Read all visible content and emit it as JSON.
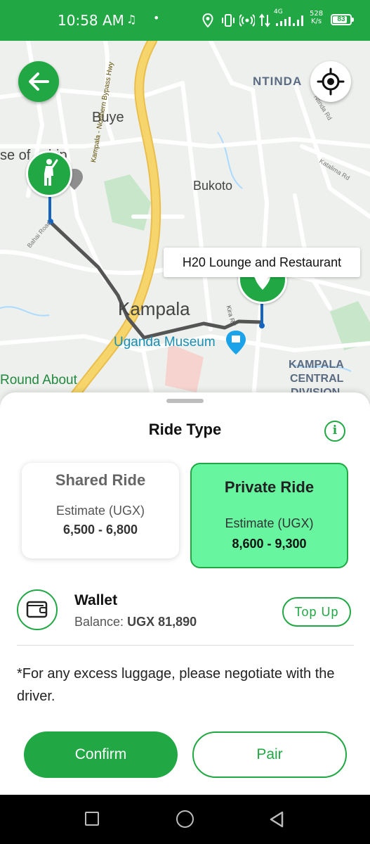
{
  "status_bar": {
    "time": "10:58 AM",
    "network_type": "4G",
    "speed_value": "528",
    "speed_unit": "K/s",
    "battery_percent": 83,
    "battery_label": "83",
    "icons": [
      "music-note-icon",
      "dot-icon",
      "location-icon",
      "vibrate-icon",
      "hotspot-icon",
      "data-arrows-icon",
      "signal-icon",
      "battery-icon"
    ]
  },
  "map": {
    "labels": {
      "ntinda": "NTINDA",
      "ntinda_rd": "Ntinda Rd",
      "buye": "Buye",
      "house": "se of  ship",
      "bypass": "Kampala - Northern Bypass Hwy",
      "katalima": "Katalima Rd",
      "bukoto": "Bukoto",
      "bahai": "Bahai Road",
      "kampala": "Kampala",
      "kira": "Kira Rd",
      "museum": "Uganda Museum",
      "roundabout": "Round About",
      "central_1": "KAMPALA",
      "central_2": "CENTRAL",
      "central_3": "DIVISION"
    },
    "destination_callout": "H20 Lounge and Restaurant",
    "colors": {
      "route": "#555555",
      "pin_stick": "#1565c0",
      "highway": "#f6d66c",
      "water": "#aadaff",
      "park": "#c8e6c9"
    }
  },
  "sheet": {
    "title": "Ride Type",
    "info_glyph": "i",
    "options": [
      {
        "title": "Shared Ride",
        "estimate_label": "Estimate (UGX)",
        "range": "6,500 - 6,800",
        "selected": false
      },
      {
        "title": "Private Ride",
        "estimate_label": "Estimate (UGX)",
        "range": "8,600 - 9,300",
        "selected": true
      }
    ],
    "wallet": {
      "title": "Wallet",
      "balance_label": "Balance:",
      "balance_value": "UGX 81,890",
      "topup_label": "Top Up"
    },
    "note": "*For any excess luggage, please negotiate with the driver.",
    "confirm_label": "Confirm",
    "pair_label": "Pair"
  },
  "colors": {
    "accent": "#21a844",
    "selected_card": "#67f5a0"
  }
}
